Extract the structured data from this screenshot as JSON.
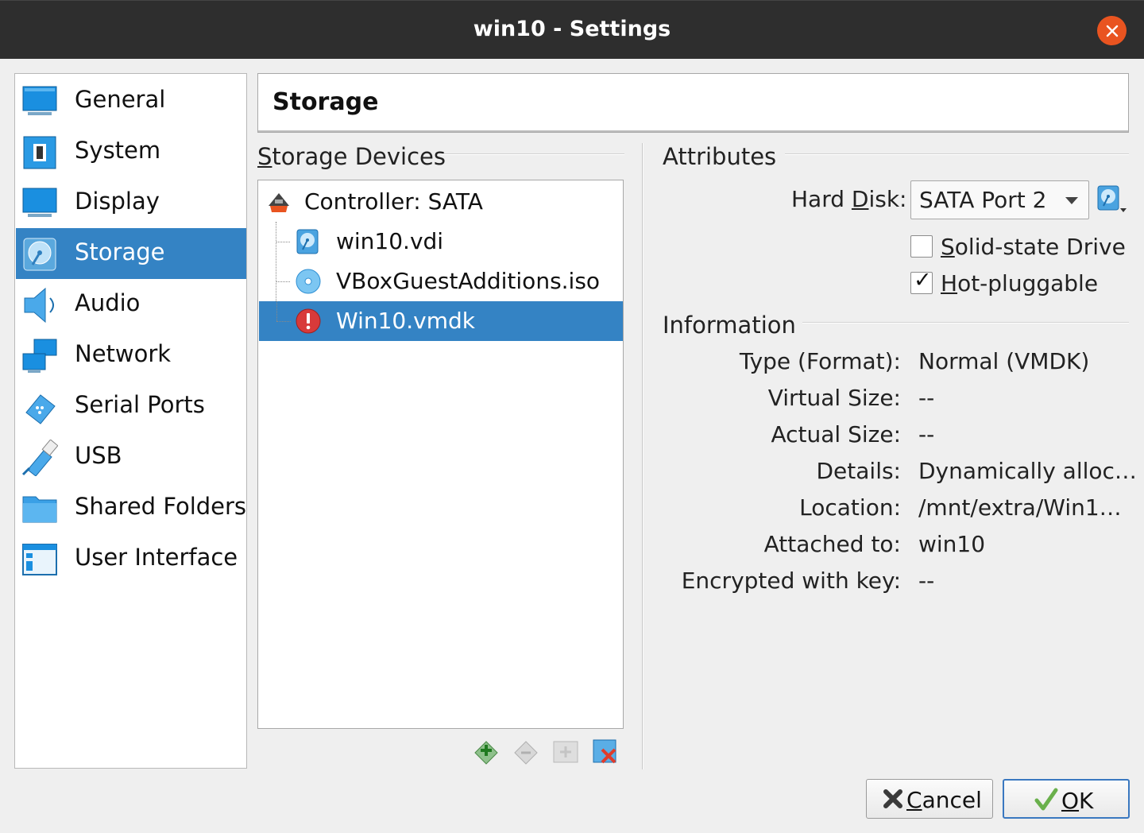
{
  "window": {
    "title": "win10 - Settings",
    "close_icon": "close-icon"
  },
  "sidebar": {
    "items": [
      {
        "label": "General",
        "icon": "monitor-icon",
        "selected": false
      },
      {
        "label": "System",
        "icon": "chip-icon",
        "selected": false
      },
      {
        "label": "Display",
        "icon": "display-icon",
        "selected": false
      },
      {
        "label": "Storage",
        "icon": "disk-icon",
        "selected": true
      },
      {
        "label": "Audio",
        "icon": "speaker-icon",
        "selected": false
      },
      {
        "label": "Network",
        "icon": "network-icon",
        "selected": false
      },
      {
        "label": "Serial Ports",
        "icon": "serial-port-icon",
        "selected": false
      },
      {
        "label": "USB",
        "icon": "usb-icon",
        "selected": false
      },
      {
        "label": "Shared Folders",
        "icon": "folder-icon",
        "selected": false
      },
      {
        "label": "User Interface",
        "icon": "window-icon",
        "selected": false
      }
    ]
  },
  "page": {
    "title": "Storage"
  },
  "storage_devices": {
    "heading": "Storage Devices",
    "heading_mnemonic": "S",
    "heading_rest": "torage Devices",
    "controller": {
      "label": "Controller: SATA",
      "icon": "controller-icon"
    },
    "items": [
      {
        "label": "win10.vdi",
        "icon": "hard-disk-icon",
        "selected": false
      },
      {
        "label": "VBoxGuestAdditions.iso",
        "icon": "optical-disc-icon",
        "selected": false
      },
      {
        "label": "Win10.vmdk",
        "icon": "error-icon",
        "selected": true
      }
    ],
    "toolbar": [
      "add-controller-icon",
      "remove-controller-icon",
      "add-attachment-icon",
      "remove-attachment-icon"
    ]
  },
  "attributes": {
    "heading": "Attributes",
    "hard_disk_label_pre": "Hard ",
    "hard_disk_label_mnemonic": "D",
    "hard_disk_label_post": "isk:",
    "hard_disk_value": "SATA Port 2",
    "solid_state": {
      "mnemonic": "S",
      "rest": "olid-state Drive",
      "checked": false
    },
    "hot_pluggable": {
      "mnemonic": "H",
      "rest": "ot-pluggable",
      "checked": true
    },
    "check_mark": "✓"
  },
  "information": {
    "heading": "Information",
    "rows": [
      {
        "label": "Type (Format):",
        "value": "Normal (VMDK)"
      },
      {
        "label": "Virtual Size:",
        "value": "--"
      },
      {
        "label": "Actual Size:",
        "value": "--"
      },
      {
        "label": "Details:",
        "value": "Dynamically alloc…"
      },
      {
        "label": "Location:",
        "value": "/mnt/extra/Win1…"
      },
      {
        "label": "Attached to:",
        "value": "win10"
      },
      {
        "label": "Encrypted with key:",
        "value": "--"
      }
    ]
  },
  "buttons": {
    "cancel": {
      "mnemonic": "C",
      "rest": "ancel"
    },
    "ok": {
      "mnemonic": "O",
      "rest": "K"
    }
  },
  "colors": {
    "selection": "#3483c4",
    "title_bar": "#2e2e2e",
    "close": "#e95420"
  }
}
